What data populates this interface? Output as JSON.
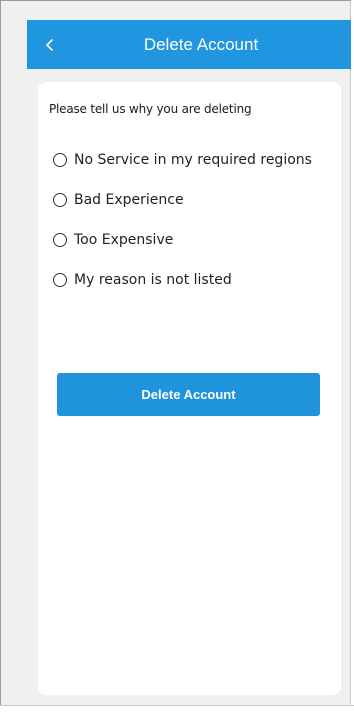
{
  "header": {
    "title": "Delete Account",
    "back_icon": "chevron-left-icon",
    "background_color": "#2196e0"
  },
  "form": {
    "prompt": "Please tell us why you are deleting",
    "reasons": [
      "No Service in my required regions",
      "Bad Experience",
      "Too Expensive",
      "My reason is not listed"
    ],
    "submit_label": "Delete Account",
    "submit_color": "#1f93dc"
  }
}
